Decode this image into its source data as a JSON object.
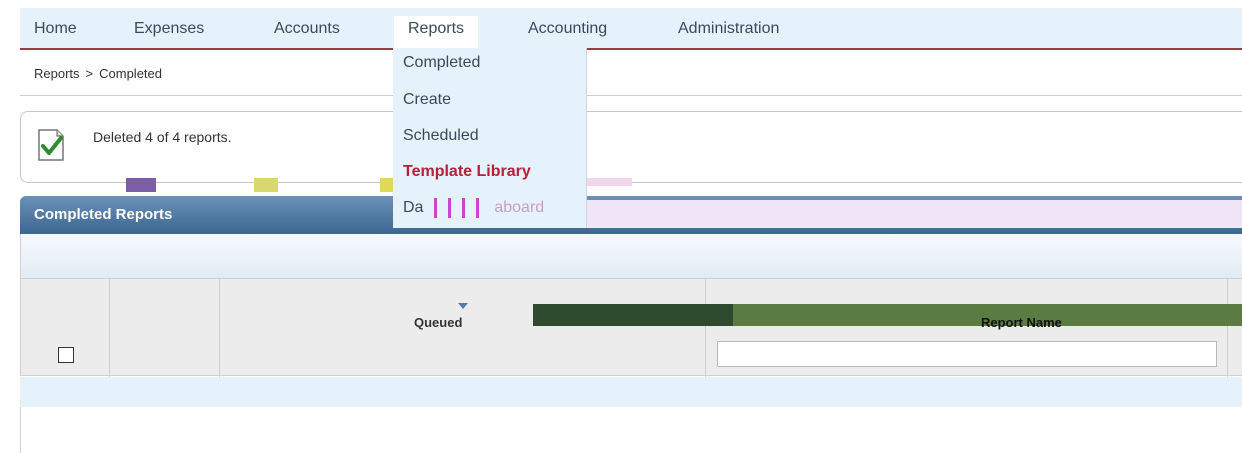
{
  "nav": {
    "home": "Home",
    "expenses": "Expenses",
    "accounts": "Accounts",
    "reports": "Reports",
    "accounting": "Accounting",
    "administration": "Administration"
  },
  "breadcrumb": {
    "root": "Reports",
    "sep": ">",
    "current": "Completed"
  },
  "message": {
    "text": "Deleted 4 of 4 reports.",
    "icon": "check-document-icon"
  },
  "panel": {
    "title": "Completed Reports"
  },
  "grid": {
    "columns": [
      "Queued",
      "Report Name"
    ],
    "filter_placeholder": ""
  },
  "menu": {
    "items": [
      "Completed",
      "Create",
      "Scheduled",
      "Template Library",
      "Dashboard"
    ],
    "dashboard_prefix": "Da",
    "dashboard_suffix": "aboard"
  },
  "colors": {
    "nav_bg": "#e6f2fb",
    "accent": "#9a3b45",
    "panel": "#3d6690",
    "highlight": "#b6203a"
  }
}
